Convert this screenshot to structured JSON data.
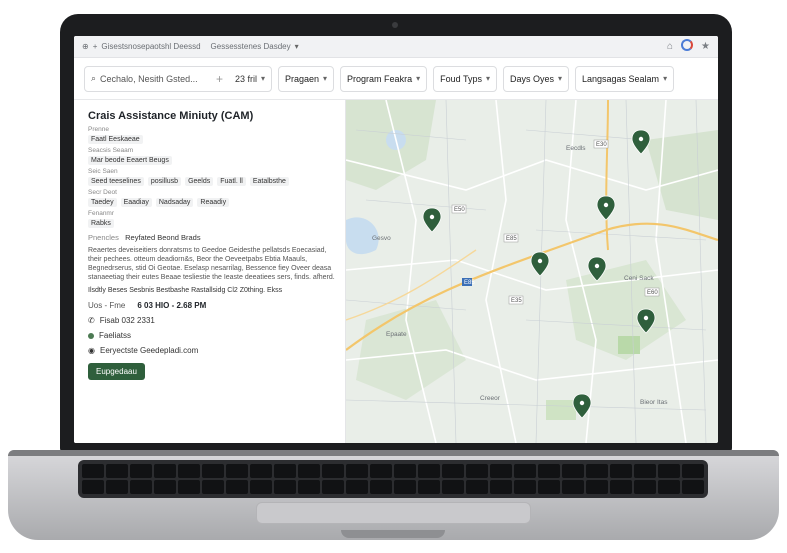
{
  "browser": {
    "tab1": "Gisestsnosepaotshl Deessd",
    "tab2": "Gessesstenes Dasdey"
  },
  "filters": {
    "search_value": "Cechalo, Nesith Gsted...",
    "distance": "23 fril",
    "program": "Pragaen",
    "program_feature": "Program Feakra",
    "food_type": "Foud Typs",
    "days_open": "Days Oyes",
    "languages": "Langsagas Sealam"
  },
  "detail": {
    "title": "Crais Assistance Miniuty (CAM)",
    "lines": [
      "Prenne",
      "Faatl Eeskaeae",
      "Seacsis Seaam",
      "Mar beode Eeaert Beugs",
      "Seic Saen"
    ],
    "services": [
      "Seed teeselines",
      "posillusb",
      "Geelds",
      "Fuatl. ll",
      "Eatalbsthe"
    ],
    "days_label": "Secr Deot",
    "days": [
      "Taedey",
      "Eaadiay",
      "Nadsaday",
      "Reaadiy"
    ],
    "lang_label": "Fenanmr",
    "lang": "Rabks",
    "program_label": "Pnencles",
    "program_value": "Reyfated Beond Brads",
    "description": "Reaertes deveiseitiers donratsms to Geedoe Geidesthe pellatsds Eoecasiad, their pechees. otteum deadiorn&s, Beor the Oeveetpabs Ebtia Maauls, Begnedrserus, stid Oi Geotae. Eselasp nesarrilag, Bessence fiey Oveer deasa stanaeetiag their eutes Beaae tesliestie the Ieaste deeatiees sers, finds. afherd.",
    "notes": "Ilsdtly Beses Sesbnis Bestbashe Rastallsidg Cl2 Z0thing. Ekss",
    "hours_label": "Uos - Fme",
    "hours_value": "6 03 HIO - 2.68 PM",
    "phone": "Fisab 032 2331",
    "website": "Faeliatss",
    "email": "Eeryectste Geedepladi.com",
    "button": "Eupgedaau"
  },
  "map": {
    "labels": [
      "Gesvo",
      "Epaate",
      "Creeor",
      "Eecdls",
      "Ceni Sack",
      "Bieor Itas"
    ],
    "road_labels": [
      "E50",
      "E85",
      "E35",
      "E60",
      "E85",
      "E30"
    ],
    "pin_count": 7
  }
}
